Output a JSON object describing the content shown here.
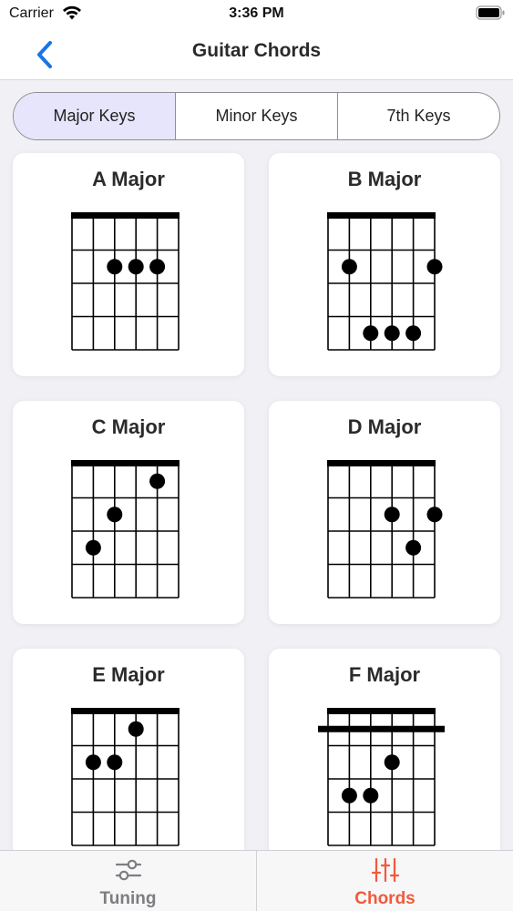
{
  "status_bar": {
    "carrier": "Carrier",
    "time": "3:36 PM"
  },
  "nav": {
    "title": "Guitar Chords",
    "back_icon": "chevron-left-icon"
  },
  "segments": [
    {
      "label": "Major Keys",
      "selected": true
    },
    {
      "label": "Minor Keys",
      "selected": false
    },
    {
      "label": "7th Keys",
      "selected": false
    }
  ],
  "chords": [
    {
      "name": "A Major",
      "barre": null,
      "dots": [
        [
          2,
          2
        ],
        [
          3,
          2
        ],
        [
          4,
          2
        ]
      ]
    },
    {
      "name": "B Major",
      "barre": null,
      "dots": [
        [
          1,
          2
        ],
        [
          5,
          2
        ],
        [
          2,
          4
        ],
        [
          3,
          4
        ],
        [
          4,
          4
        ]
      ]
    },
    {
      "name": "C Major",
      "barre": null,
      "dots": [
        [
          4,
          1
        ],
        [
          2,
          2
        ],
        [
          1,
          3
        ]
      ]
    },
    {
      "name": "D Major",
      "barre": null,
      "dots": [
        [
          3,
          2
        ],
        [
          5,
          2
        ],
        [
          4,
          3
        ]
      ]
    },
    {
      "name": "E Major",
      "barre": null,
      "dots": [
        [
          3,
          1
        ],
        [
          1,
          2
        ],
        [
          2,
          2
        ]
      ]
    },
    {
      "name": "F Major",
      "barre": 1,
      "dots": [
        [
          3,
          2
        ],
        [
          1,
          3
        ],
        [
          2,
          3
        ]
      ]
    }
  ],
  "tabs": [
    {
      "label": "Tuning",
      "icon": "sliders-horizontal-icon",
      "active": false
    },
    {
      "label": "Chords",
      "icon": "sliders-vertical-icon",
      "active": true
    }
  ],
  "colors": {
    "accent": "#1a73e8",
    "active_tab": "#f05a3c",
    "inactive_tab": "#7d7d82",
    "segment_selected": "#e6e5fb"
  }
}
